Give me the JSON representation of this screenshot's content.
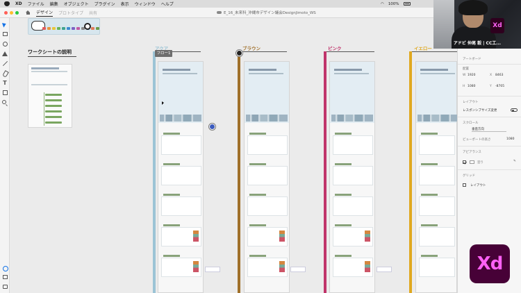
{
  "menubar": {
    "app": "XD",
    "items": [
      "ファイル",
      "編集",
      "オブジェクト",
      "プラグイン",
      "表示",
      "ウィンドウ",
      "ヘルプ"
    ],
    "battery": "100%"
  },
  "appbar": {
    "tabs": [
      "デザイン",
      "プロトタイプ",
      "共有"
    ],
    "document_title": "E_16_未来科_沖縄市デザイン議会DesignJimoto_WS"
  },
  "canvas": {
    "worksheet_title": "ワークシートの説明",
    "flow_button": "フロー1",
    "columns": [
      {
        "label": "アクア",
        "color": "#9cc4d6"
      },
      {
        "label": "ブラウン",
        "color": "#a0702a"
      },
      {
        "label": "ピンク",
        "color": "#c0346b"
      },
      {
        "label": "イエロー",
        "color": "#e0a81f"
      }
    ],
    "banner_chip_colors": [
      "#e25b5b",
      "#e7963c",
      "#e8c63a",
      "#67b35b",
      "#3fa38f",
      "#3b8ad1",
      "#7b62c4",
      "#c25aa3",
      "#8b8b8b",
      "#5aa0d1",
      "#e07b5a",
      "#6b9b4a"
    ]
  },
  "panel": {
    "section_title": "アートボード",
    "position_label": "配置",
    "w_label": "W",
    "w_value": "1920",
    "x_label": "X",
    "x_value": "8463",
    "h_label": "H",
    "h_value": "1080",
    "y_label": "Y",
    "y_value": "-8705",
    "layout_label": "レイアウト",
    "responsive_label": "レスポンシブサイズ変更",
    "scroll_label": "スクロール",
    "scroll_value": "垂直方向",
    "viewport_label": "ビューポートの高さ",
    "viewport_value": "1080",
    "appearance_label": "アピアランス",
    "fill_label": "塗り",
    "grid_label": "グリッド",
    "grid_value": "レイアウト"
  },
  "webcam": {
    "caption": "アドビ 仲尾 毅 | CC工..."
  },
  "brand": {
    "logo_text": "Xd",
    "accent": "#ff61f6",
    "logo_bg": "#470137"
  }
}
